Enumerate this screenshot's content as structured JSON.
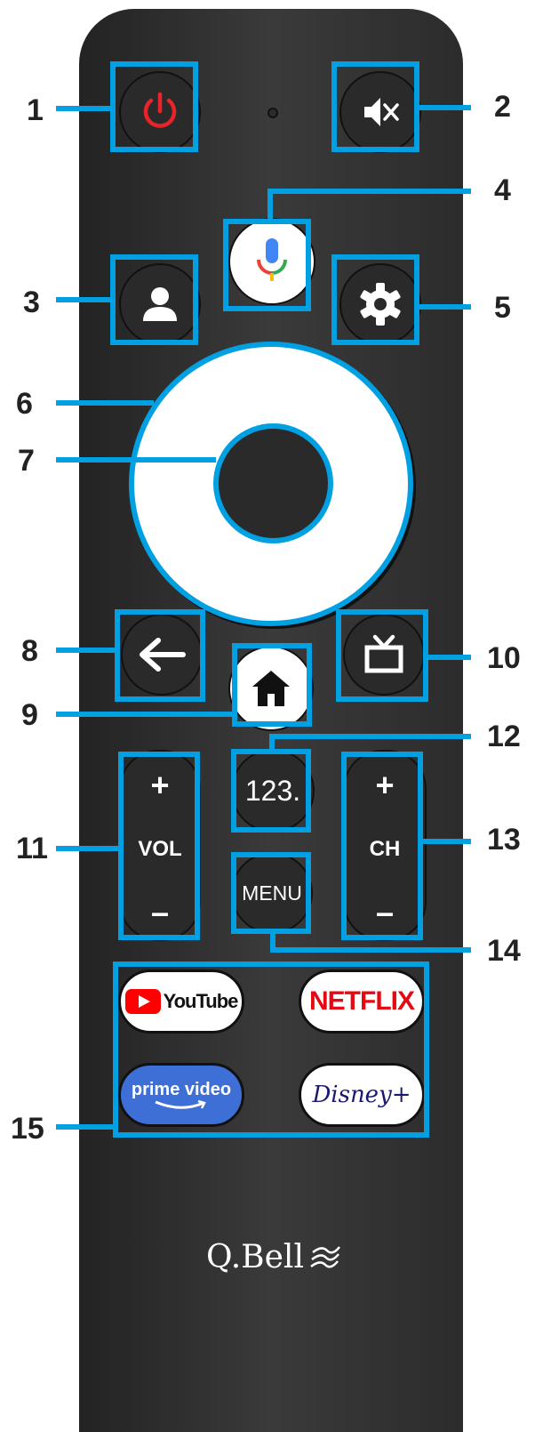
{
  "callouts": [
    "1",
    "2",
    "3",
    "4",
    "5",
    "6",
    "7",
    "8",
    "9",
    "10",
    "11",
    "12",
    "13",
    "14",
    "15"
  ],
  "buttons": {
    "vol": {
      "plus": "+",
      "label": "VOL",
      "minus": "–"
    },
    "ch": {
      "plus": "+",
      "label": "CH",
      "minus": "–"
    },
    "numbers_label": "123.",
    "menu_label": "MENU"
  },
  "apps": {
    "youtube": "YouTube",
    "netflix": "NETFLIX",
    "prime": "prime video",
    "disney": "Disney+"
  },
  "brand": "Q.Bell",
  "colors": {
    "highlight": "#00a0e3",
    "power": "#e8232a",
    "netflix": "#e50914",
    "prime": "#3d6fd6",
    "disney": "#1a1a6e",
    "youtube": "#ff0000"
  },
  "icons": [
    "power-icon",
    "mute-icon",
    "user-icon",
    "mic-icon",
    "gear-icon",
    "back-arrow-icon",
    "home-icon",
    "tv-icon"
  ]
}
